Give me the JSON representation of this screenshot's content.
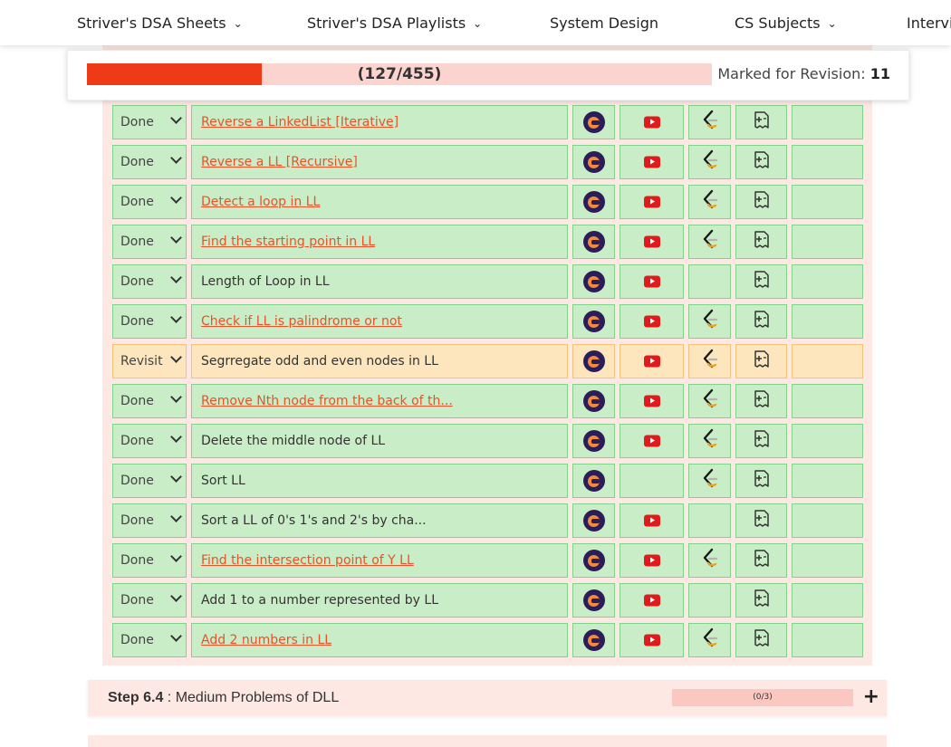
{
  "nav": {
    "items": [
      {
        "label": "Striver's DSA Sheets",
        "has_chevron": true
      },
      {
        "label": "Striver's DSA Playlists",
        "has_chevron": true
      },
      {
        "label": "System Design",
        "has_chevron": false
      },
      {
        "label": "CS Subjects",
        "has_chevron": true
      },
      {
        "label": "Intervi",
        "has_chevron": false
      }
    ]
  },
  "progress": {
    "label": "(127/455)",
    "fraction": 0.279,
    "revision_label": "Marked for Revision:",
    "revision_count": "11"
  },
  "colors": {
    "done_bg": "#c9edc6",
    "done_border": "#7fd38a",
    "revisit_bg": "#fde5bd",
    "revisit_border": "#f2c478",
    "link": "#e9522a",
    "progress_fill": "#ee3a16"
  },
  "rows": [
    {
      "status": "Done",
      "name": "Reverse a LinkedList [Iterative]",
      "link": true,
      "cn": true,
      "yt": true,
      "lc": true,
      "note": true
    },
    {
      "status": "Done",
      "name": "Reverse a LL [Recursive]",
      "link": true,
      "cn": true,
      "yt": true,
      "lc": true,
      "note": true
    },
    {
      "status": "Done",
      "name": "Detect a loop in LL",
      "link": true,
      "cn": true,
      "yt": true,
      "lc": true,
      "note": true
    },
    {
      "status": "Done",
      "name": "Find the starting point in LL",
      "link": true,
      "cn": true,
      "yt": true,
      "lc": true,
      "note": true
    },
    {
      "status": "Done",
      "name": "Length of Loop in LL",
      "link": false,
      "cn": true,
      "yt": true,
      "lc": false,
      "note": true
    },
    {
      "status": "Done",
      "name": "Check if LL is palindrome or not",
      "link": true,
      "cn": true,
      "yt": true,
      "lc": true,
      "note": true
    },
    {
      "status": "Revisit",
      "name": "Segrregate odd and even nodes in LL",
      "link": false,
      "cn": true,
      "yt": true,
      "lc": true,
      "note": true
    },
    {
      "status": "Done",
      "name": "Remove Nth node from the back of th...",
      "link": true,
      "cn": true,
      "yt": true,
      "lc": true,
      "note": true
    },
    {
      "status": "Done",
      "name": "Delete the middle node of LL",
      "link": false,
      "cn": true,
      "yt": true,
      "lc": true,
      "note": true
    },
    {
      "status": "Done",
      "name": "Sort LL",
      "link": false,
      "cn": true,
      "yt": false,
      "lc": true,
      "note": true
    },
    {
      "status": "Done",
      "name": "Sort a LL of 0's 1's and 2's by cha...",
      "link": false,
      "cn": true,
      "yt": true,
      "lc": false,
      "note": true
    },
    {
      "status": "Done",
      "name": "Find the intersection point of Y LL",
      "link": true,
      "cn": true,
      "yt": true,
      "lc": true,
      "note": true
    },
    {
      "status": "Done",
      "name": "Add 1 to a number represented by LL",
      "link": false,
      "cn": true,
      "yt": true,
      "lc": false,
      "note": true
    },
    {
      "status": "Done",
      "name": "Add 2 numbers in LL",
      "link": true,
      "cn": true,
      "yt": true,
      "lc": true,
      "note": true
    }
  ],
  "step": {
    "label": "Step 6.4",
    "title": " : Medium Problems of DLL",
    "progress_label": "(0/3)",
    "expand": "+"
  }
}
